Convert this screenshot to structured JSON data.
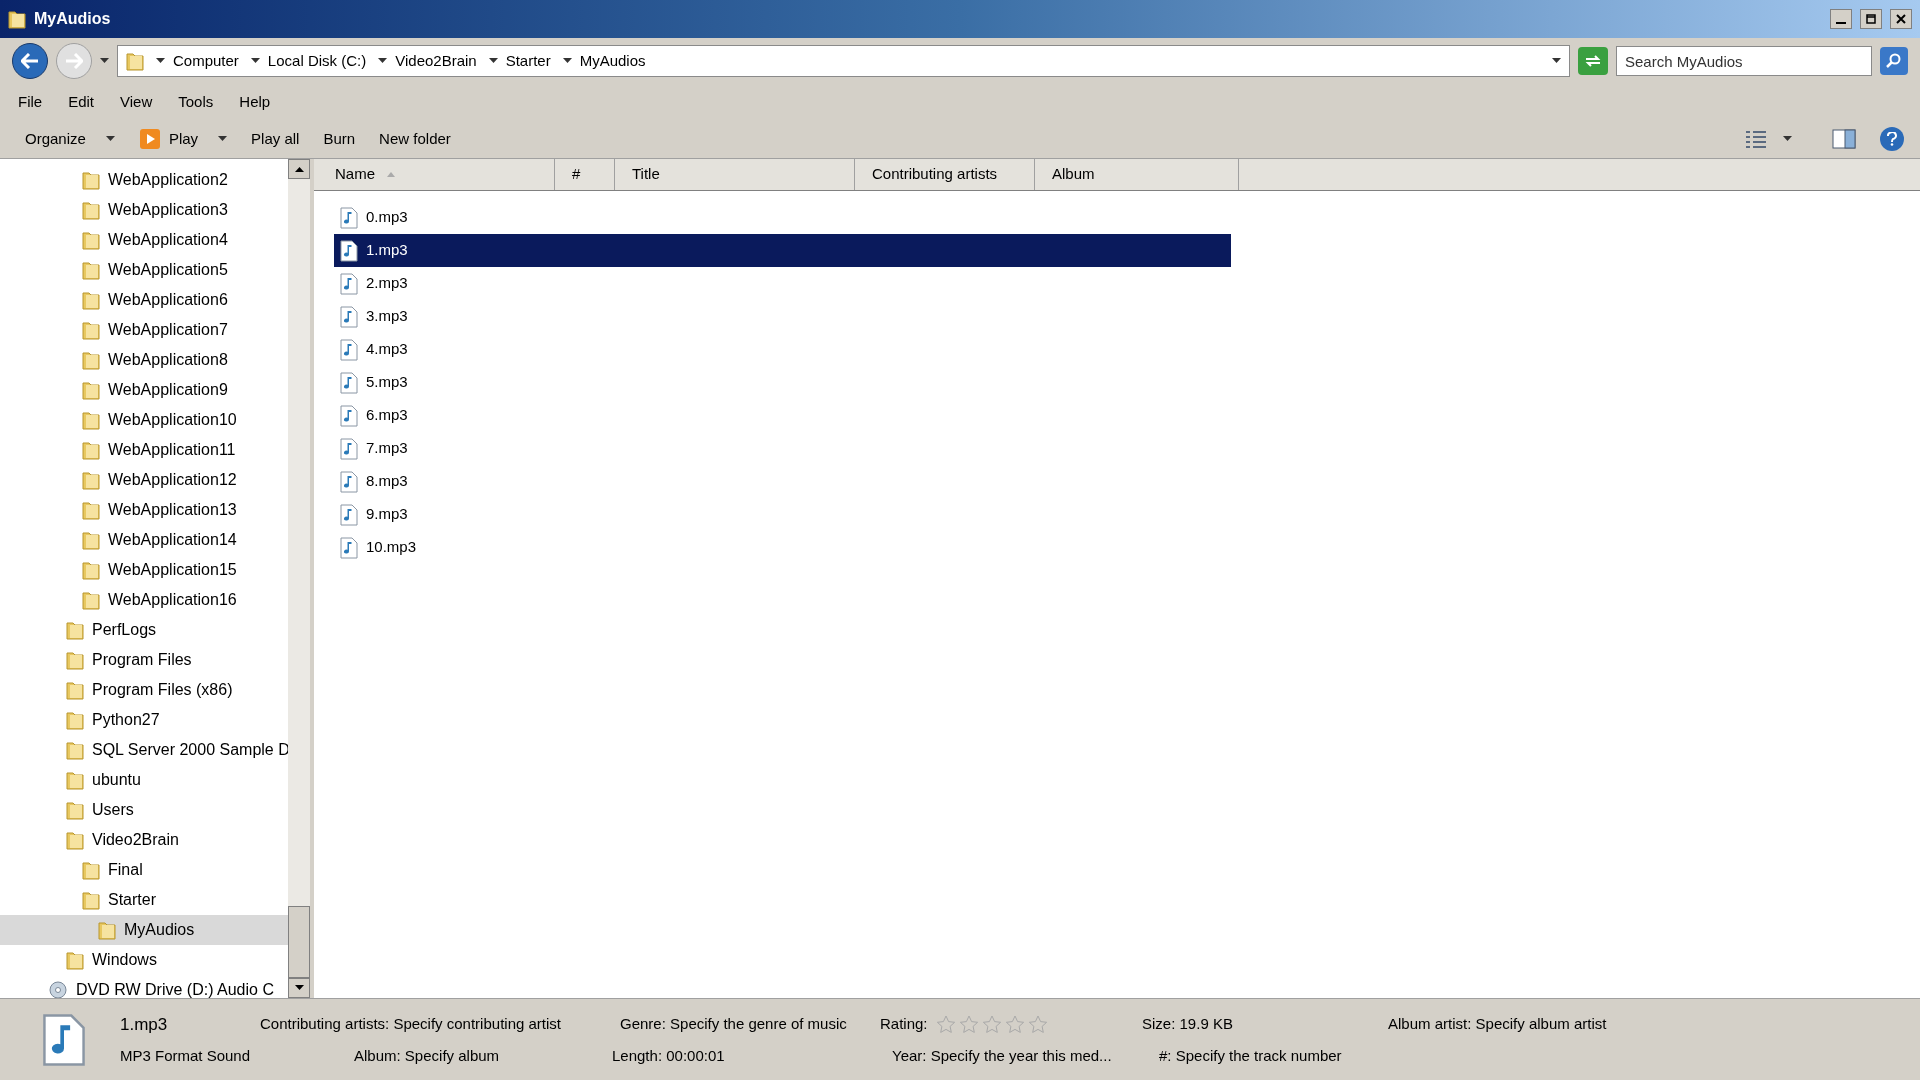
{
  "window": {
    "title": "MyAudios"
  },
  "address": {
    "crumbs": [
      "Computer",
      "Local Disk (C:)",
      "Video2Brain",
      "Starter",
      "MyAudios"
    ]
  },
  "search": {
    "placeholder": "Search MyAudios"
  },
  "menu": [
    "File",
    "Edit",
    "View",
    "Tools",
    "Help"
  ],
  "toolbar": [
    {
      "label": "Organize",
      "kind": "dropdown"
    },
    {
      "label": "Play",
      "kind": "play"
    },
    {
      "label": "Play all",
      "kind": "plain"
    },
    {
      "label": "Burn",
      "kind": "plain"
    },
    {
      "label": "New folder",
      "kind": "plain"
    }
  ],
  "tree": [
    {
      "children": [
        {
          "children": [
            {
              "label": "WebApplication2",
              "selected": false
            },
            {
              "label": "WebApplication3",
              "selected": false
            },
            {
              "label": "WebApplication4",
              "selected": false
            },
            {
              "label": "WebApplication5",
              "selected": false
            },
            {
              "label": "WebApplication6",
              "selected": false
            },
            {
              "label": "WebApplication7",
              "selected": false
            },
            {
              "label": "WebApplication8",
              "selected": false
            },
            {
              "label": "WebApplication9",
              "selected": false
            },
            {
              "label": "WebApplication10",
              "selected": false
            },
            {
              "label": "WebApplication11",
              "selected": false
            },
            {
              "label": "WebApplication12",
              "selected": false
            },
            {
              "label": "WebApplication13",
              "selected": false
            },
            {
              "label": "WebApplication14",
              "selected": false
            },
            {
              "label": "WebApplication15",
              "selected": false
            },
            {
              "label": "WebApplication16",
              "selected": false
            }
          ]
        },
        {
          "label": "PerfLogs",
          "selected": false
        },
        {
          "label": "Program Files",
          "selected": false
        },
        {
          "label": "Program Files (x86)",
          "selected": false
        },
        {
          "label": "Python27",
          "selected": false
        },
        {
          "label": "SQL Server 2000 Sample D",
          "selected": false
        },
        {
          "label": "ubuntu",
          "selected": false
        },
        {
          "label": "Users",
          "selected": false
        },
        {
          "label": "Video2Brain",
          "selected": false,
          "children": [
            {
              "label": "Final",
              "selected": false
            },
            {
              "label": "Starter",
              "selected": false,
              "children": [
                {
                  "label": "MyAudios",
                  "selected": true
                }
              ]
            }
          ]
        },
        {
          "label": "Windows",
          "selected": false
        }
      ]
    },
    {
      "label": "DVD RW Drive (D:) Audio C",
      "kind": "drive",
      "selected": false
    }
  ],
  "table": {
    "columns": [
      "Name",
      "#",
      "Title",
      "Contributing artists",
      "Album"
    ],
    "rows": [
      {
        "name": "0.mp3",
        "selected": false
      },
      {
        "name": "1.mp3",
        "selected": true
      },
      {
        "name": "2.mp3",
        "selected": false
      },
      {
        "name": "3.mp3",
        "selected": false
      },
      {
        "name": "4.mp3",
        "selected": false
      },
      {
        "name": "5.mp3",
        "selected": false
      },
      {
        "name": "6.mp3",
        "selected": false
      },
      {
        "name": "7.mp3",
        "selected": false
      },
      {
        "name": "8.mp3",
        "selected": false
      },
      {
        "name": "9.mp3",
        "selected": false
      },
      {
        "name": "10.mp3",
        "selected": false
      }
    ]
  },
  "details": {
    "name": "1.mp3",
    "type": "MP3 Format Sound",
    "line1": [
      {
        "label": "Contributing artists:",
        "value": "Specify contributing artist"
      },
      {
        "label": "Genre:",
        "value": "Specify the genre of music"
      },
      {
        "label": "Rating:",
        "kind": "rating",
        "stars": 0
      },
      {
        "label": "Size:",
        "value": "19.9 KB"
      },
      {
        "label": "Album artist:",
        "value": "Specify album artist"
      }
    ],
    "line2": [
      {
        "label": "Album:",
        "value": "Specify album"
      },
      {
        "label": "Length:",
        "value": "00:00:01"
      },
      {
        "label": "Year:",
        "value": "Specify the year this med..."
      },
      {
        "label": "#:",
        "value": "Specify the track number"
      }
    ]
  }
}
